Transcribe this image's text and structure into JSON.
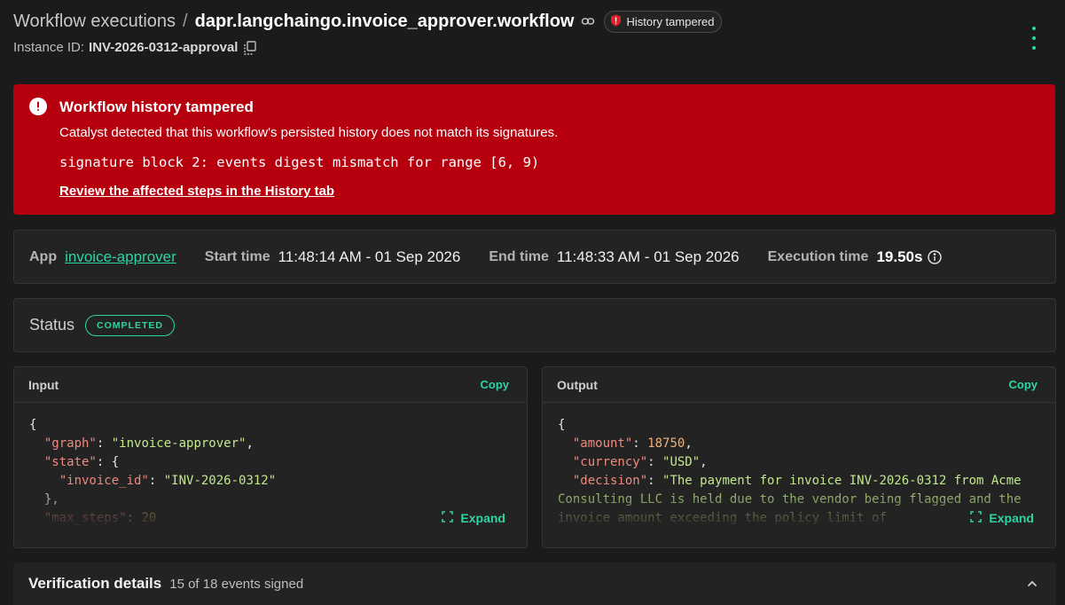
{
  "header": {
    "breadcrumb_root": "Workflow executions",
    "separator": "/",
    "workflow_name": "dapr.langchaingo.invoice_approver.workflow",
    "badge_label": "History tampered",
    "instance_label": "Instance ID:",
    "instance_id": "INV-2026-0312-approval"
  },
  "alert": {
    "title": "Workflow history tampered",
    "message": "Catalyst detected that this workflow's persisted history does not match its signatures.",
    "detail": "signature block 2: events digest mismatch for range [6, 9)",
    "link": "Review the affected steps in the History tab"
  },
  "meta": {
    "app_label": "App",
    "app_value": "invoice-approver",
    "start_label": "Start time",
    "start_value": "11:48:14 AM - 01 Sep 2026",
    "end_label": "End time",
    "end_value": "11:48:33 AM - 01 Sep 2026",
    "exec_label": "Execution time",
    "exec_value": "19.50s"
  },
  "status": {
    "label": "Status",
    "value": "COMPLETED"
  },
  "input": {
    "title": "Input",
    "copy": "Copy",
    "expand": "Expand",
    "lines": [
      {
        "punct": "{"
      },
      {
        "indent": "  ",
        "key": "\"graph\"",
        "sep": ": ",
        "str": "\"invoice-approver\"",
        "tail": ","
      },
      {
        "indent": "  ",
        "key": "\"state\"",
        "sep": ": ",
        "tail": "{"
      },
      {
        "indent": "    ",
        "key": "\"invoice_id\"",
        "sep": ": ",
        "str": "\"INV-2026-0312\""
      },
      {
        "indent": "  ",
        "tail": "},"
      },
      {
        "indent": "  ",
        "key": "\"max_steps\"",
        "sep": ": ",
        "num": "20"
      }
    ]
  },
  "output": {
    "title": "Output",
    "copy": "Copy",
    "expand": "Expand",
    "lines": [
      {
        "punct": "{"
      },
      {
        "indent": "  ",
        "key": "\"amount\"",
        "sep": ": ",
        "num": "18750",
        "tail": ","
      },
      {
        "indent": "  ",
        "key": "\"currency\"",
        "sep": ": ",
        "str": "\"USD\"",
        "tail": ","
      },
      {
        "indent": "  ",
        "key": "\"decision\"",
        "sep": ": ",
        "str": "\"The payment for invoice INV-2026-0312 from Acme Consulting LLC is held due to the vendor being flagged and the invoice amount exceeding the policy limit of"
      }
    ]
  },
  "verification": {
    "title": "Verification details",
    "summary": "15 of 18 events signed"
  },
  "colors": {
    "accent": "#2dd4a4",
    "alert": "#b7000e",
    "background": "#1b1b1b"
  }
}
